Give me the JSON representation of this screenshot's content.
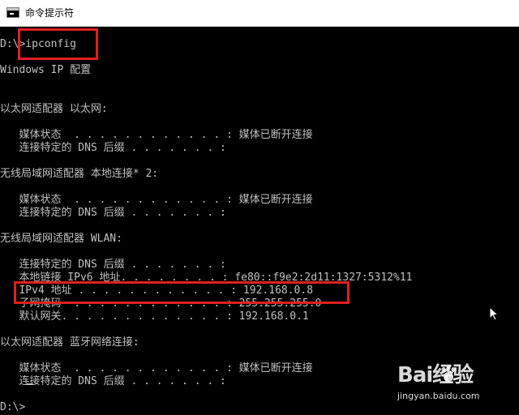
{
  "window": {
    "title": "命令提示符"
  },
  "console": {
    "lines": [
      "D:\\>ipconfig",
      "Windows IP 配置",
      "以太网适配器 以太网:",
      "   媒体状态  . . . . . . . . . . . . : 媒体已断开连接",
      "   连接特定的 DNS 后缀 . . . . . . . :",
      "无线局域网适配器 本地连接* 2:",
      "   媒体状态  . . . . . . . . . . . . : 媒体已断开连接",
      "   连接特定的 DNS 后缀 . . . . . . . :",
      "无线局域网适配器 WLAN:",
      "   连接特定的 DNS 后缀 . . . . . . . :",
      "   本地链接 IPv6 地址. . . . . . . . : fe80::f9e2:2d11:1327:5312%11",
      "   IPv4 地址 . . . . . . . . . . . . : 192.168.0.8",
      "   子网掩码  . . . . . . . . . . . . : 255.255.255.0",
      "   默认网关. . . . . . . . . . . . . : 192.168.0.1",
      "以太网适配器 蓝牙网络连接:",
      "   媒体状态  . . . . . . . . . . . . : 媒体已断开连接",
      "   连接特定的 DNS 后缀 . . . . . . . :",
      "D:\\>"
    ]
  },
  "watermark": {
    "logo": "Bai经验",
    "site": "jingyan.baidu.com"
  }
}
